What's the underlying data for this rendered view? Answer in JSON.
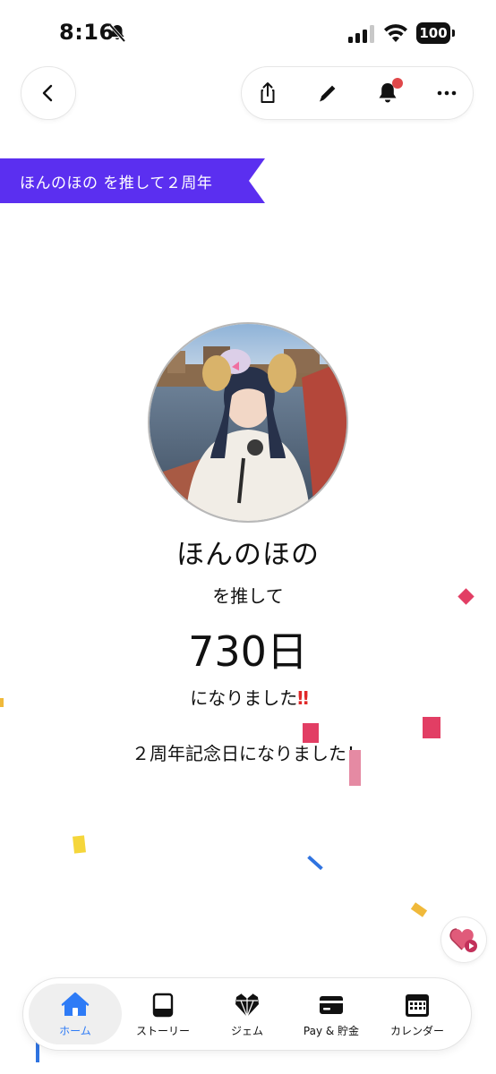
{
  "status_bar": {
    "time": "8:16",
    "battery": "100",
    "icons": [
      "bell-slash-icon",
      "cellular-signal-icon",
      "wifi-icon",
      "battery-icon"
    ]
  },
  "top_nav": {
    "back_icon": "chevron-left-icon",
    "actions": [
      "share-icon",
      "pencil-icon",
      "bell-icon",
      "more-icon"
    ]
  },
  "ribbon": {
    "text": "ほんのほの を推して２周年",
    "color": "#5b2ff0"
  },
  "profile": {
    "name": "ほんのほの",
    "oshite": "を推して",
    "days": "730日",
    "narimashita": "になりました",
    "exclamation": "‼",
    "memorial": "２周年記念日になりました！"
  },
  "floating_button": {
    "icon": "heart-play-icon"
  },
  "tabbar": {
    "tabs": [
      {
        "label": "ホーム",
        "icon": "home-icon",
        "active": true
      },
      {
        "label": "ストーリー",
        "icon": "notebook-icon",
        "active": false
      },
      {
        "label": "ジェム",
        "icon": "gem-heart-icon",
        "active": false
      },
      {
        "label": "Pay & 貯金",
        "icon": "card-icon",
        "active": false
      },
      {
        "label": "カレンダー",
        "icon": "calendar-icon",
        "active": false
      }
    ]
  },
  "colors": {
    "accent": "#2e7bf6",
    "ribbon": "#5b2ff0",
    "exclamation": "#e02929",
    "notification": "#e0484a"
  }
}
